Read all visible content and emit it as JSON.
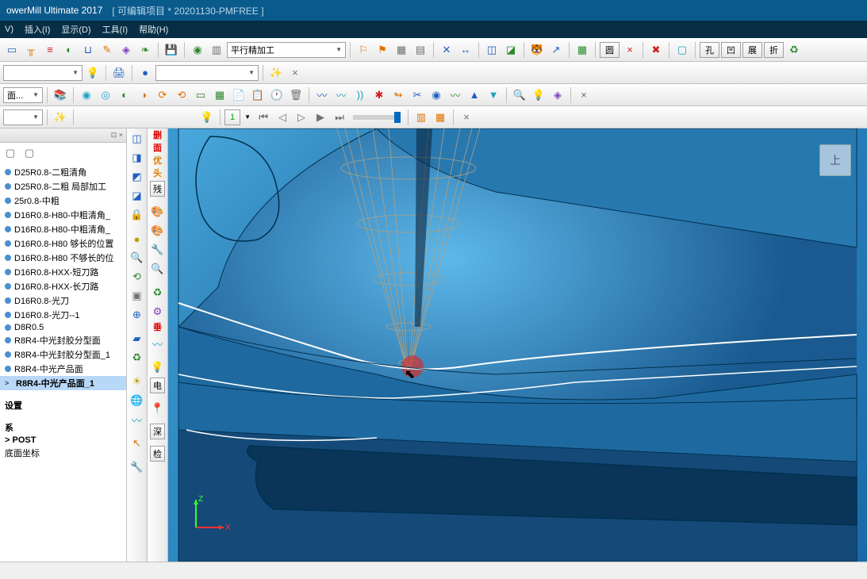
{
  "title": {
    "app": "owerMill Ultimate 2017",
    "project": "[ 可编辑项目 * 20201130-PMFREE ]"
  },
  "menu": {
    "view": "V)",
    "insert": "插入(I)",
    "display": "显示(D)",
    "tools": "工具(I)",
    "help": "帮助(H)"
  },
  "toolbar1": {
    "strategy_combo": "平行精加工",
    "btn_round": "圆",
    "btn_hole": "孔",
    "btn_concave": "凹",
    "btn_spread": "展",
    "btn_fold": "折"
  },
  "toolbar2": {
    "combo1": "",
    "combo2": ""
  },
  "toolbar3": {
    "combo1": "面..."
  },
  "toolbar4": {
    "combo1": "",
    "frame": "1"
  },
  "explorer": {
    "items": [
      {
        "label": "D25R0.8-二粗清角",
        "bullet": true
      },
      {
        "label": "D25R0.8-二粗 局部加工",
        "bullet": true
      },
      {
        "label": "25r0.8-中粗",
        "bullet": true
      },
      {
        "label": "D16R0.8-H80-中粗清角_",
        "bullet": true
      },
      {
        "label": "D16R0.8-H80-中粗清角_",
        "bullet": true
      },
      {
        "label": "D16R0.8-H80  够长的位置",
        "bullet": true
      },
      {
        "label": "D16R0.8-H80  不够长的位",
        "bullet": true
      },
      {
        "label": "D16R0.8-HXX-短刀路",
        "bullet": true
      },
      {
        "label": "D16R0.8-HXX-长刀路",
        "bullet": true
      },
      {
        "label": "D16R0.8-光刀",
        "bullet": true
      },
      {
        "label": "D16R0.8-光刀--1",
        "bullet": true
      },
      {
        "label": "D8R0.5",
        "bullet": true
      },
      {
        "label": "R8R4-中光封胶分型面",
        "bullet": true
      },
      {
        "label": "R8R4-中光封胶分型面_1",
        "bullet": true
      },
      {
        "label": "R8R4-中光产品面",
        "bullet": true
      },
      {
        "label": "R8R4-中光产品面_1",
        "bullet": true,
        "sel": true,
        "prefix": ">"
      }
    ],
    "groups": [
      {
        "label": "设置",
        "bold": true
      },
      {
        "label": ""
      },
      {
        "label": "系",
        "bold": true
      },
      {
        "label": "> POST",
        "bold": true
      },
      {
        "label": "底面坐标"
      }
    ]
  },
  "vbar1": {
    "labels": [
      "删",
      "面",
      "优",
      "头"
    ],
    "btn_residue": "残",
    "btn_vert": "垂"
  },
  "vbar2": {
    "btn_elec": "电",
    "btn_deep": "深",
    "btn_check": "检"
  },
  "viewport": {
    "cube": "上",
    "axes": {
      "x": "X",
      "z": "Z"
    }
  },
  "close_x": "×"
}
